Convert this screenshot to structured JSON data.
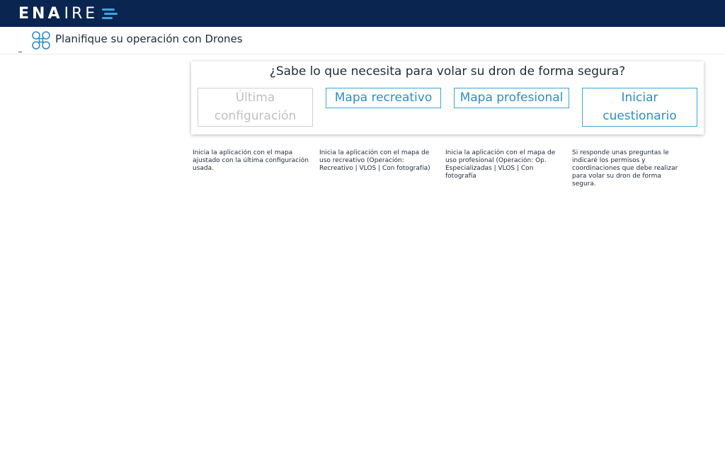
{
  "header": {
    "logo_bold": "ENA",
    "logo_light": "IRE",
    "logo_accent_color": "#3aa6dc",
    "bar_color": "#0a2550"
  },
  "subheader": {
    "icon": "drone-icon",
    "title": "Planifique su operación con Drones"
  },
  "panel": {
    "question": "¿Sabe lo que necesita para volar su dron de forma segura?",
    "options": [
      {
        "label": "Última configuración",
        "disabled": true,
        "description": "Inicia la aplicación con el mapa ajustado con la última configuración usada."
      },
      {
        "label": "Mapa recreativo",
        "disabled": false,
        "description": "Inicia la aplicación con el mapa de uso recreativo (Operación: Recreativo | VLOS | Con fotografía)"
      },
      {
        "label": "Mapa profesional",
        "disabled": false,
        "description": "Inicia la aplicación con el mapa de uso profesional (Operación: Op. Especializadas | VLOS | Con fotografía"
      },
      {
        "label": "Iniciar cuestionario",
        "disabled": false,
        "description": "Si responde unas preguntas le indicaré los permisos y coordinaciones que debe realizar para volar su dron de forma segura."
      }
    ]
  }
}
